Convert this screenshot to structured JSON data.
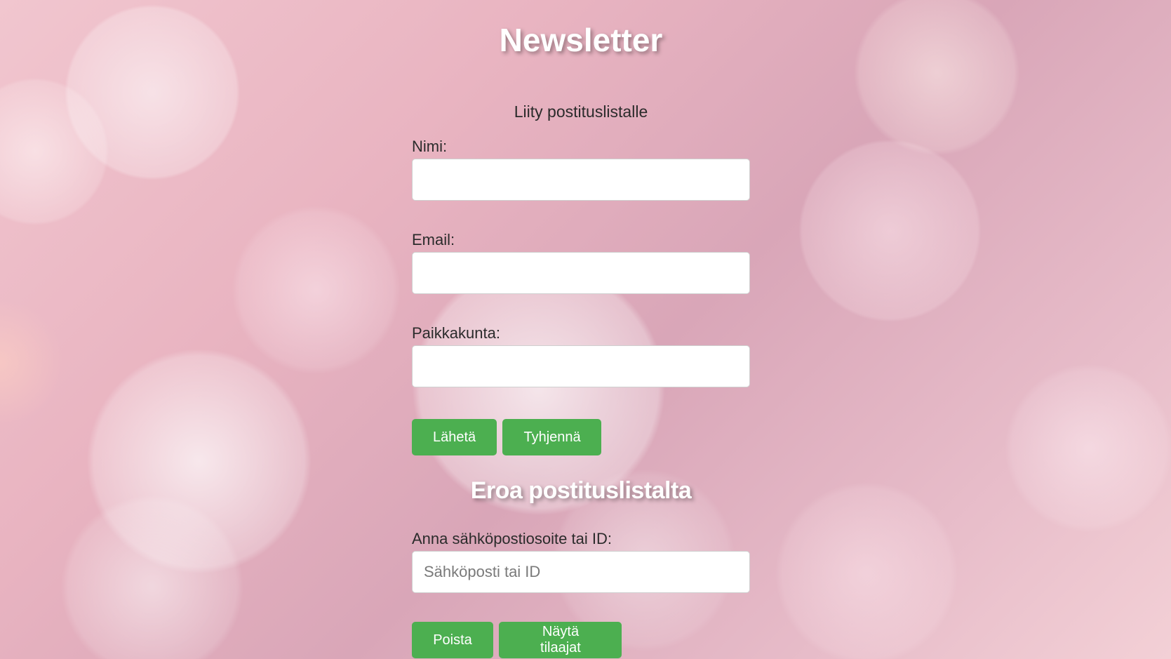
{
  "header": {
    "title": "Newsletter",
    "subtitle": "Liity postituslistalle"
  },
  "subscribe_form": {
    "name_label": "Nimi:",
    "name_value": "",
    "email_label": "Email:",
    "email_value": "",
    "city_label": "Paikkakunta:",
    "city_value": "",
    "submit_label": "Lähetä",
    "clear_label": "Tyhjennä"
  },
  "unsubscribe_form": {
    "title": "Eroa postituslistalta",
    "field_label": "Anna sähköpostiosoite tai ID:",
    "field_placeholder": "Sähköposti tai ID",
    "field_value": "",
    "delete_label": "Poista",
    "show_label": "Näytä tilaajat"
  },
  "colors": {
    "button": "#4caf50",
    "title": "#ffffff",
    "text": "#2b2b2b"
  }
}
